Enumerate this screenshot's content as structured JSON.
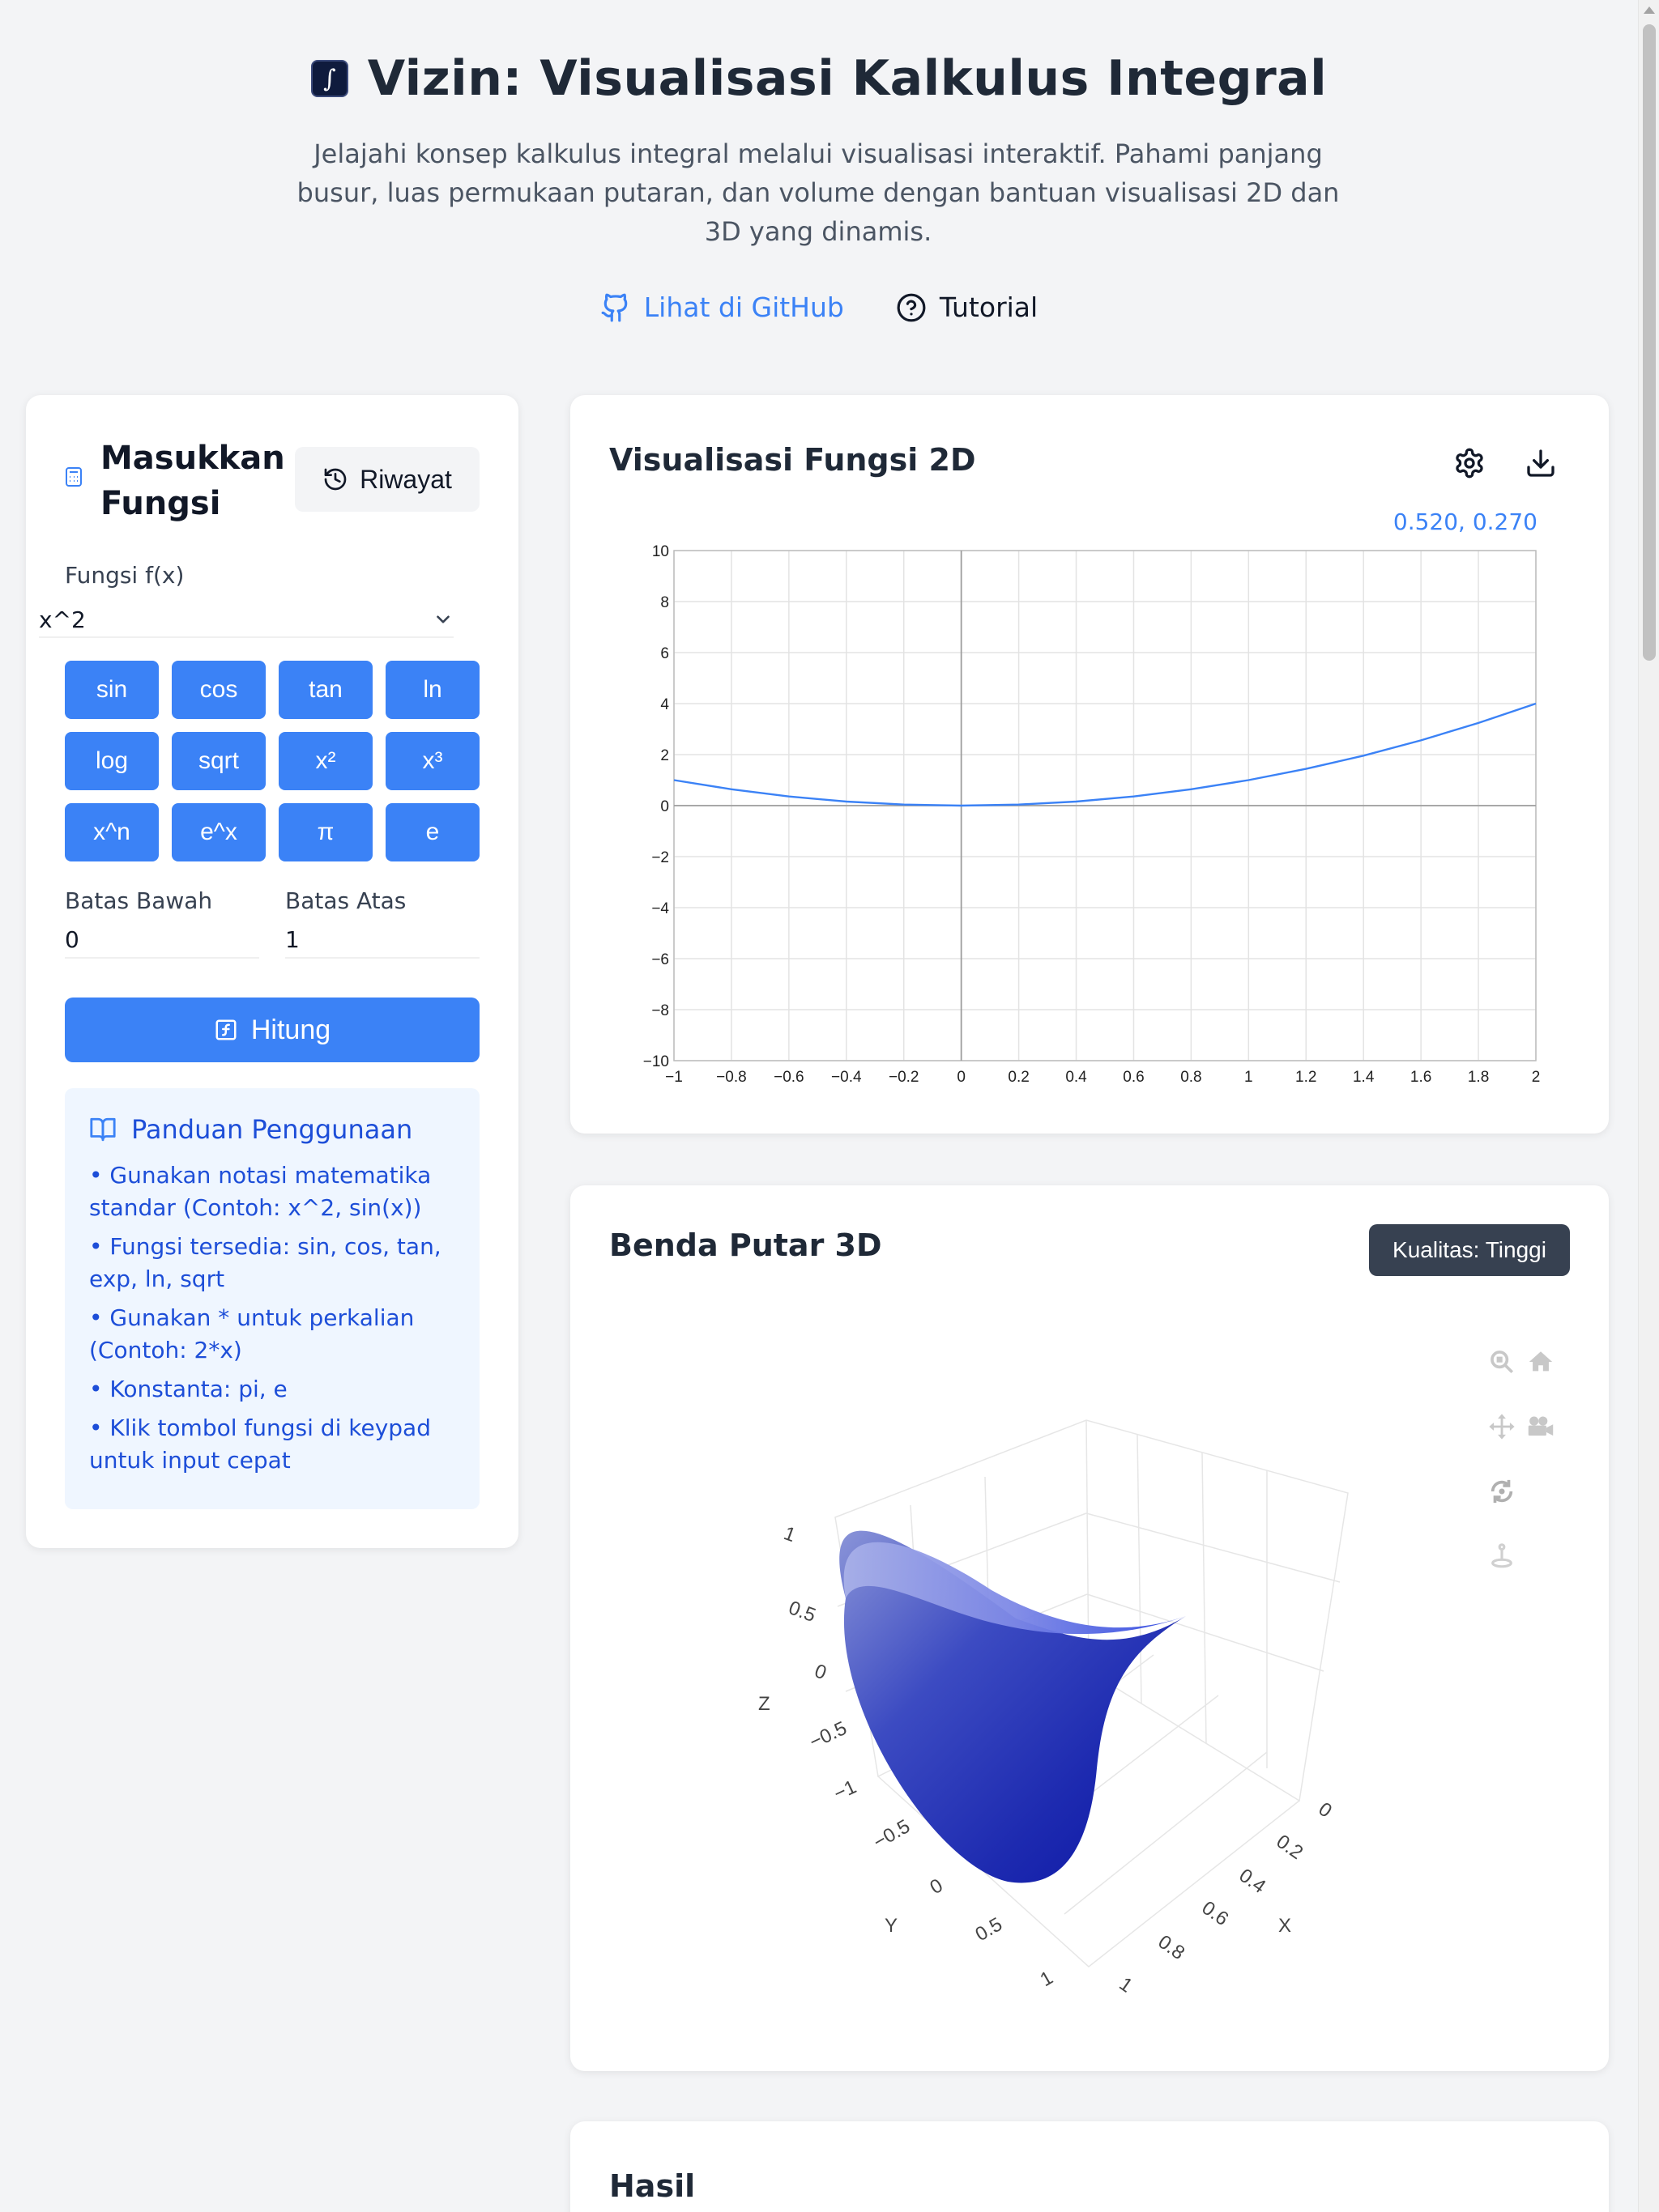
{
  "header": {
    "title": "Vizin: Visualisasi Kalkulus Integral",
    "subtitle": "Jelajahi konsep kalkulus integral melalui visualisasi interaktif. Pahami panjang busur, luas permukaan putaran, dan volume dengan bantuan visualisasi 2D dan 3D yang dinamis.",
    "github_label": "Lihat di GitHub",
    "tutorial_label": "Tutorial"
  },
  "input_panel": {
    "title": "Masukkan Fungsi",
    "history_label": "Riwayat",
    "function_label": "Fungsi f(x)",
    "function_value": "x^2",
    "keys": [
      "sin",
      "cos",
      "tan",
      "ln",
      "log",
      "sqrt",
      "x²",
      "x³",
      "x^n",
      "e^x",
      "π",
      "e"
    ],
    "lower_label": "Batas Bawah",
    "lower_value": "0",
    "upper_label": "Batas Atas",
    "upper_value": "1",
    "calculate_label": "Hitung",
    "guide": {
      "title": "Panduan Penggunaan",
      "items": [
        "• Gunakan notasi matematika standar (Contoh: x^2, sin(x))",
        "• Fungsi tersedia: sin, cos, tan, exp, ln, sqrt",
        "• Gunakan * untuk perkalian (Contoh: 2*x)",
        "• Konstanta: pi, e",
        "• Klik tombol fungsi di keypad untuk input cepat"
      ]
    }
  },
  "viz2d": {
    "title": "Visualisasi Fungsi 2D",
    "coordinate_readout": "0.520, 0.270"
  },
  "viz3d": {
    "title": "Benda Putar 3D",
    "quality_label": "Kualitas: Tinggi",
    "axis_x": "X",
    "axis_y": "Y",
    "axis_z": "Z",
    "x_ticks": [
      "0",
      "0.2",
      "0.4",
      "0.6",
      "0.8",
      "1"
    ],
    "y_ticks": [
      "−0.5",
      "0",
      "0.5",
      "1"
    ],
    "z_ticks": [
      "1",
      "0.5",
      "0",
      "−0.5",
      "−1"
    ]
  },
  "results": {
    "title": "Hasil"
  },
  "chart_data": {
    "type": "line",
    "function": "x^2",
    "xlim": [
      -1,
      2
    ],
    "ylim": [
      -10,
      10
    ],
    "x_ticks": [
      -1,
      -0.8,
      -0.6,
      -0.4,
      -0.2,
      0,
      0.2,
      0.4,
      0.6,
      0.8,
      1,
      1.2,
      1.4,
      1.6,
      1.8,
      2
    ],
    "y_ticks": [
      -10,
      -8,
      -6,
      -4,
      -2,
      0,
      2,
      4,
      6,
      8,
      10
    ],
    "grid": true,
    "series": [
      {
        "color": "#3b82f6",
        "x": [
          -1,
          -0.8,
          -0.6,
          -0.4,
          -0.2,
          0,
          0.2,
          0.4,
          0.6,
          0.8,
          1,
          1.2,
          1.4,
          1.6,
          1.8,
          2
        ],
        "y": [
          1,
          0.64,
          0.36,
          0.16,
          0.04,
          0,
          0.04,
          0.16,
          0.36,
          0.64,
          1,
          1.44,
          1.96,
          2.56,
          3.24,
          4
        ]
      }
    ]
  },
  "colors": {
    "primary": "#3b82f6",
    "dark": "#374151",
    "guide_bg": "#eff6ff"
  }
}
